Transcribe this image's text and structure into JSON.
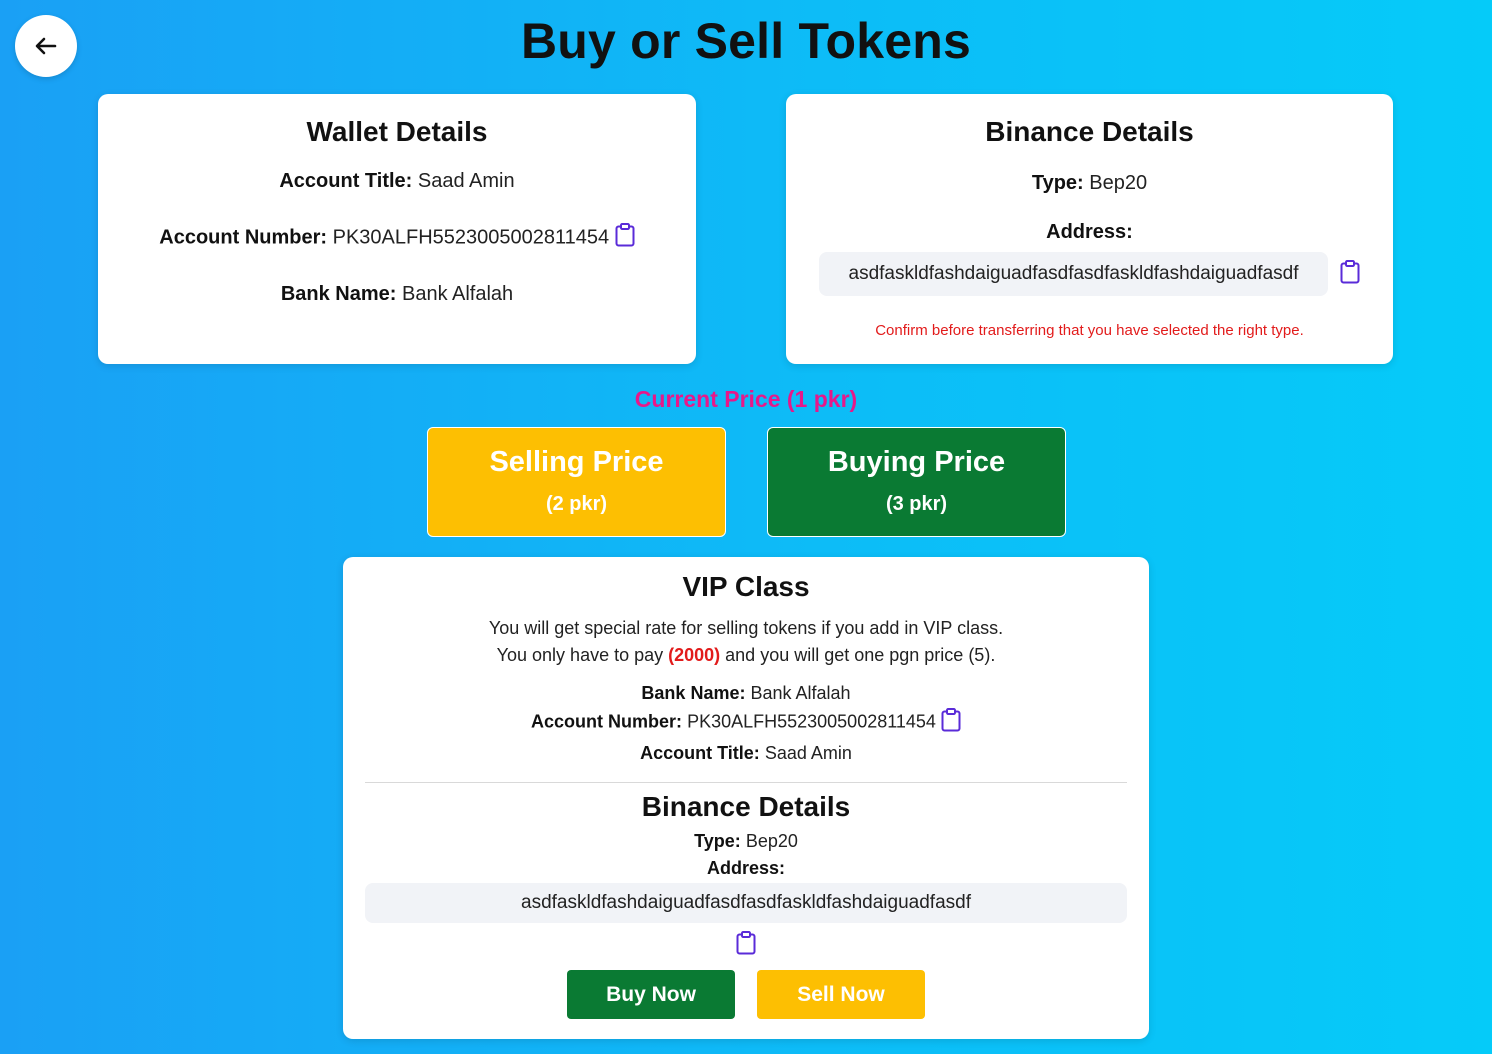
{
  "page": {
    "title": "Buy or Sell Tokens"
  },
  "icons": {
    "back": "arrow-left-icon",
    "copy": "clipboard-icon"
  },
  "colors": {
    "accent_pink": "#e7188a",
    "sell_yellow": "#fdbf02",
    "buy_green": "#0a7a33",
    "warning_red": "#e21b1b",
    "icon_purple": "#5a2bd8"
  },
  "wallet": {
    "title": "Wallet Details",
    "account_title_label": "Account Title:",
    "account_title_value": "Saad Amin",
    "account_number_label": "Account Number:",
    "account_number_value": "PK30ALFH5523005002811454",
    "bank_name_label": "Bank Name:",
    "bank_name_value": "Bank Alfalah"
  },
  "binance": {
    "title": "Binance Details",
    "type_label": "Type:",
    "type_value": "Bep20",
    "address_label": "Address:",
    "address_value": "asdfaskldfashdaiguadfasdfasdfaskldfashdaiguadfasdf",
    "warning": "Confirm before transferring that you have selected the right type."
  },
  "price": {
    "current_label": "Current Price (1 pkr)",
    "selling_title": "Selling Price",
    "selling_value": "(2 pkr)",
    "buying_title": "Buying Price",
    "buying_value": "(3 pkr)"
  },
  "vip": {
    "title": "VIP Class",
    "desc_line1": "You will get special rate for selling tokens if you add in VIP class.",
    "desc_line2_pre": "You only have to pay ",
    "desc_line2_amount": "(2000)",
    "desc_line2_post": " and you will get one pgn price (5).",
    "bank_name_label": "Bank Name:",
    "bank_name_value": "Bank Alfalah",
    "account_number_label": "Account Number:",
    "account_number_value": "PK30ALFH5523005002811454",
    "account_title_label": "Account Title:",
    "account_title_value": "Saad Amin",
    "binance_title": "Binance Details",
    "type_label": "Type:",
    "type_value": "Bep20",
    "address_label": "Address:",
    "address_value": "asdfaskldfashdaiguadfasdfasdfaskldfashdaiguadfasdf",
    "buy_label": "Buy Now",
    "sell_label": "Sell Now"
  }
}
